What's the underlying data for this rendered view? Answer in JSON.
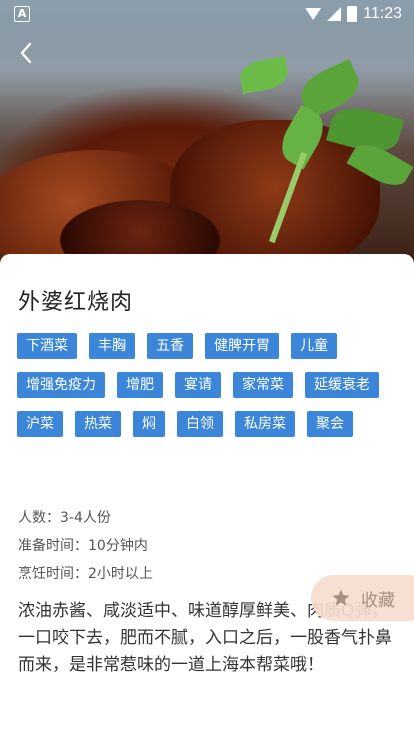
{
  "status_bar": {
    "time": "11:23",
    "notification_icon": "A"
  },
  "recipe": {
    "title": "外婆红烧肉",
    "tags": [
      "下酒菜",
      "丰胸",
      "五香",
      "健脾开胃",
      "儿童",
      "增强免疫力",
      "增肥",
      "宴请",
      "家常菜",
      "延缓衰老",
      "沪菜",
      "热菜",
      "焖",
      "白领",
      "私房菜",
      "聚会"
    ],
    "servings": "人数：3-4人份",
    "prep_time": "准备时间：10分钟内",
    "cook_time": "烹饪时间：2小时以上",
    "description": "浓油赤酱、咸淡适中、味道醇厚鲜美、肉质Q弹，一口咬下去，肥而不腻，入口之后，一股香气扑鼻而来，是非常惹味的一道上海本帮菜哦！"
  },
  "actions": {
    "favorite_label": "收藏"
  },
  "colors": {
    "tag_bg": "#3b86d8",
    "favorite_bg": "#f6dccd"
  },
  "icons": {
    "back": "chevron-left-icon",
    "favorite": "star-icon"
  }
}
